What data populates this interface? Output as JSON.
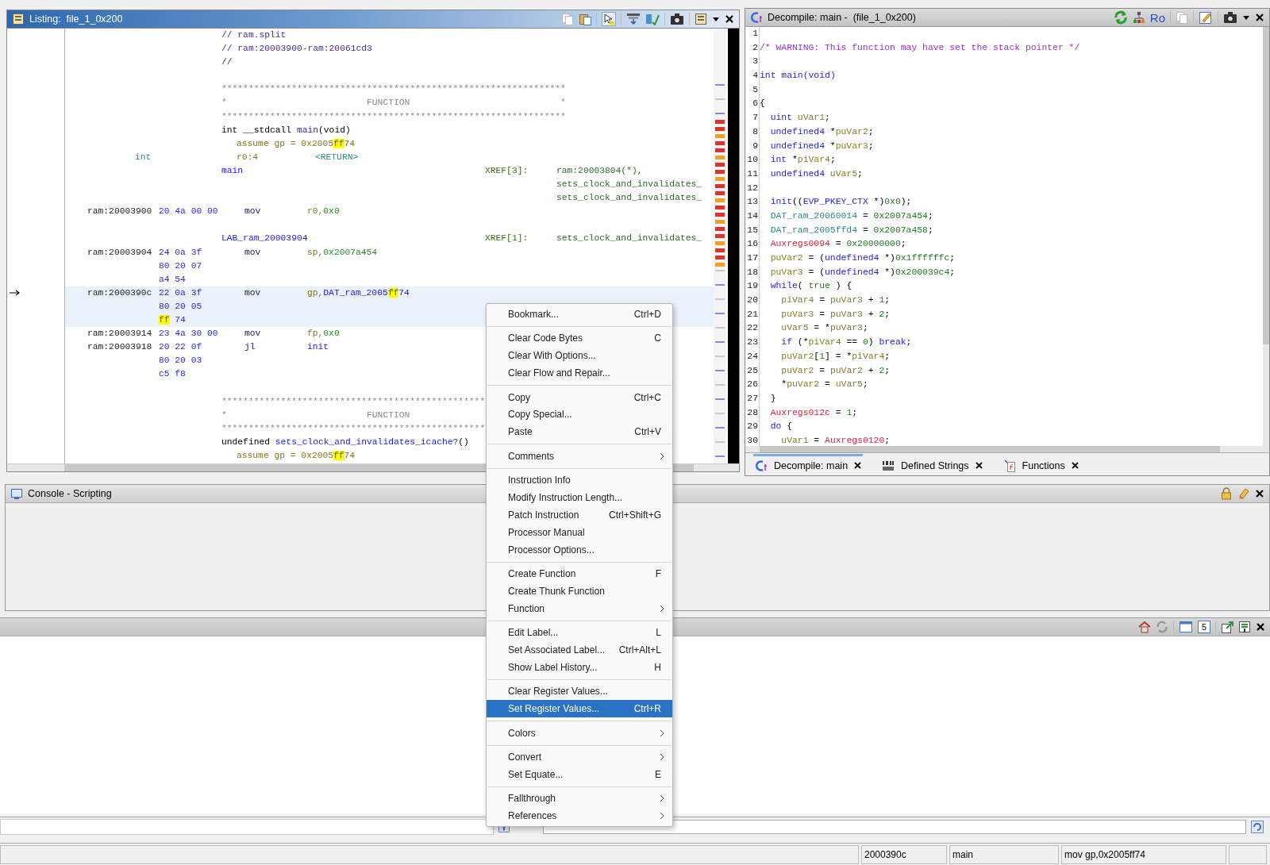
{
  "listing": {
    "title": "Listing:  file_1_0x200",
    "lines": [
      {
        "selected": false,
        "cells": [
          {
            "kind": "body",
            "parts": [
              {
                "text": "// ram.split",
                "kind": "comment"
              }
            ]
          }
        ]
      },
      {
        "selected": false,
        "cells": [
          {
            "kind": "body",
            "parts": [
              {
                "text": "// ram:20003900-ram:20061cd3",
                "kind": "comment"
              }
            ]
          }
        ]
      },
      {
        "selected": false,
        "cells": [
          {
            "kind": "body",
            "parts": [
              {
                "text": "//",
                "kind": "comment"
              }
            ]
          }
        ]
      },
      {
        "selected": false
      },
      {
        "selected": false,
        "cells": [
          {
            "kind": "body",
            "parts": [
              {
                "text": "****************************************************************",
                "kind": "stars"
              }
            ]
          }
        ]
      },
      {
        "selected": false,
        "cells": [
          {
            "kind": "body",
            "parts": [
              {
                "text": "*                          FUNCTION                            *",
                "kind": "stars"
              }
            ]
          }
        ]
      },
      {
        "selected": false,
        "cells": [
          {
            "kind": "body",
            "parts": [
              {
                "text": "****************************************************************",
                "kind": "stars"
              }
            ]
          }
        ]
      },
      {
        "selected": false,
        "cells": [
          {
            "kind": "body",
            "parts": [
              {
                "text": "int __stdcall",
                "kind": "plain"
              },
              {
                "text": " main",
                "kind": "label"
              },
              {
                "text": "(void)",
                "kind": "plain"
              }
            ]
          }
        ]
      },
      {
        "selected": false,
        "cells": [
          {
            "kind": "storage",
            "parts": [
              {
                "text": "assume gp = 0x2005",
                "kind": "olive"
              },
              {
                "text": "ff",
                "kind": "match"
              },
              {
                "text": "74",
                "kind": "olive"
              }
            ]
          }
        ]
      },
      {
        "selected": false,
        "cells": [
          {
            "kind": "type",
            "parts": [
              {
                "text": "int",
                "kind": "teal"
              }
            ]
          },
          {
            "kind": "storage",
            "parts": [
              {
                "text": "r0:4",
                "kind": "olive"
              }
            ]
          },
          {
            "kind": "return",
            "parts": [
              {
                "text": "<RETURN>",
                "kind": "teal"
              }
            ]
          }
        ]
      },
      {
        "selected": false,
        "cells": [
          {
            "kind": "body",
            "parts": [
              {
                "text": "main",
                "kind": "label"
              }
            ]
          },
          {
            "kind": "xref",
            "parts": [
              {
                "text": "XREF[3]:",
                "kind": "xref"
              }
            ]
          },
          {
            "kind": "target",
            "parts": [
              {
                "text": "ram:20003804(*),",
                "kind": "target"
              }
            ]
          }
        ]
      },
      {
        "selected": false,
        "cells": [
          {
            "kind": "target",
            "parts": [
              {
                "text": "sets_clock_and_invalidates_",
                "kind": "target"
              }
            ]
          }
        ]
      },
      {
        "selected": false,
        "cells": [
          {
            "kind": "target",
            "parts": [
              {
                "text": "sets_clock_and_invalidates_",
                "kind": "target"
              }
            ]
          }
        ]
      },
      {
        "selected": false,
        "cells": [
          {
            "kind": "address",
            "parts": [
              {
                "text": "ram:20003900",
                "kind": "address"
              }
            ]
          },
          {
            "kind": "bytes",
            "parts": [
              {
                "text": "20 4a 00 00",
                "kind": "bytes"
              }
            ]
          },
          {
            "kind": "mnemonic",
            "parts": [
              {
                "text": "mov",
                "kind": "mnemonic"
              }
            ]
          },
          {
            "kind": "operands",
            "parts": [
              {
                "text": "r0,",
                "kind": "olive"
              },
              {
                "text": "0x0",
                "kind": "scalar"
              }
            ]
          }
        ]
      },
      {
        "selected": false
      },
      {
        "selected": false,
        "cells": [
          {
            "kind": "body",
            "parts": [
              {
                "text": "LAB_ram_20003904",
                "kind": "label"
              }
            ]
          },
          {
            "kind": "xref",
            "parts": [
              {
                "text": "XREF[1]:",
                "kind": "xref"
              }
            ]
          },
          {
            "kind": "target",
            "parts": [
              {
                "text": "sets_clock_and_invalidates_",
                "kind": "target"
              }
            ]
          }
        ]
      },
      {
        "selected": false,
        "cells": [
          {
            "kind": "address",
            "parts": [
              {
                "text": "ram:20003904",
                "kind": "address"
              }
            ]
          },
          {
            "kind": "bytes",
            "parts": [
              {
                "text": "24 0a 3f",
                "kind": "bytes"
              }
            ]
          },
          {
            "kind": "mnemonic",
            "parts": [
              {
                "text": "mov",
                "kind": "mnemonic"
              }
            ]
          },
          {
            "kind": "operands",
            "parts": [
              {
                "text": "sp,",
                "kind": "olive"
              },
              {
                "text": "0x2007a454",
                "kind": "scalar"
              }
            ]
          }
        ]
      },
      {
        "selected": false,
        "cells": [
          {
            "kind": "bytes",
            "parts": [
              {
                "text": "80 20 07",
                "kind": "bytes"
              }
            ]
          }
        ]
      },
      {
        "selected": false,
        "cells": [
          {
            "kind": "bytes",
            "parts": [
              {
                "text": "a4 54",
                "kind": "bytes"
              }
            ]
          }
        ]
      },
      {
        "selected": true,
        "cells": [
          {
            "kind": "address",
            "parts": [
              {
                "text": "ram:2000390c",
                "kind": "address"
              }
            ]
          },
          {
            "kind": "bytes",
            "parts": [
              {
                "text": "22 0a 3f",
                "kind": "bytes"
              }
            ]
          },
          {
            "kind": "mnemonic",
            "parts": [
              {
                "text": "mov",
                "kind": "mnemonic"
              }
            ]
          },
          {
            "kind": "operands",
            "parts": [
              {
                "text": "gp,",
                "kind": "olive"
              },
              {
                "text": "DAT_ram_2005",
                "kind": "label"
              },
              {
                "text": "ff",
                "kind": "match"
              },
              {
                "text": "74",
                "kind": "label"
              }
            ]
          }
        ]
      },
      {
        "selected": true,
        "cells": [
          {
            "kind": "bytes",
            "parts": [
              {
                "text": "80 20 05",
                "kind": "bytes"
              }
            ]
          }
        ]
      },
      {
        "selected": true,
        "cells": [
          {
            "kind": "bytes",
            "parts": [
              {
                "text": "ff",
                "kind": "match"
              },
              {
                "text": " 74",
                "kind": "bytes"
              }
            ]
          }
        ]
      },
      {
        "selected": false,
        "cells": [
          {
            "kind": "address",
            "parts": [
              {
                "text": "ram:20003914",
                "kind": "address"
              }
            ]
          },
          {
            "kind": "bytes",
            "parts": [
              {
                "text": "23 4a 30 00",
                "kind": "bytes"
              }
            ]
          },
          {
            "kind": "mnemonic",
            "parts": [
              {
                "text": "mov",
                "kind": "mnemonic"
              }
            ]
          },
          {
            "kind": "operands",
            "parts": [
              {
                "text": "fp,",
                "kind": "olive"
              },
              {
                "text": "0x0",
                "kind": "scalar"
              }
            ]
          }
        ]
      },
      {
        "selected": false,
        "cells": [
          {
            "kind": "address",
            "parts": [
              {
                "text": "ram:20003918",
                "kind": "address"
              }
            ]
          },
          {
            "kind": "bytes",
            "parts": [
              {
                "text": "20 22 0f",
                "kind": "bytes"
              }
            ]
          },
          {
            "kind": "mnemonic",
            "parts": [
              {
                "text": "jl",
                "kind": "mnemonic"
              }
            ]
          },
          {
            "kind": "operands",
            "parts": [
              {
                "text": "init",
                "kind": "label"
              }
            ]
          }
        ]
      },
      {
        "selected": false,
        "cells": [
          {
            "kind": "bytes",
            "parts": [
              {
                "text": "80 20 03",
                "kind": "bytes"
              }
            ]
          }
        ]
      },
      {
        "selected": false,
        "cells": [
          {
            "kind": "bytes",
            "parts": [
              {
                "text": "c5 f8",
                "kind": "bytes"
              }
            ]
          }
        ]
      },
      {
        "selected": false
      },
      {
        "selected": false,
        "cells": [
          {
            "kind": "body",
            "parts": [
              {
                "text": "*************************************************",
                "kind": "stars"
              }
            ]
          }
        ]
      },
      {
        "selected": false,
        "cells": [
          {
            "kind": "body",
            "parts": [
              {
                "text": "*                          FUNCTION",
                "kind": "stars"
              }
            ]
          }
        ]
      },
      {
        "selected": false,
        "cells": [
          {
            "kind": "body",
            "parts": [
              {
                "text": "*************************************************",
                "kind": "stars"
              }
            ]
          }
        ]
      },
      {
        "selected": false,
        "cells": [
          {
            "kind": "body",
            "parts": [
              {
                "text": "undefined",
                "kind": "plain"
              },
              {
                "text": " sets_clock_and_invalidates_icache?",
                "kind": "label"
              },
              {
                "text": "()",
                "kind": "plain"
              }
            ]
          }
        ]
      },
      {
        "selected": false,
        "cells": [
          {
            "kind": "storage",
            "parts": [
              {
                "text": "assume gp = 0x2005",
                "kind": "olive"
              },
              {
                "text": "ff",
                "kind": "match"
              },
              {
                "text": "74",
                "kind": "olive"
              }
            ]
          }
        ]
      }
    ]
  },
  "decompile": {
    "title": "Decompile: main -  (file_1_0x200)",
    "toolbar_text": "Ro",
    "lines": [
      {
        "number": "1"
      },
      {
        "number": "2",
        "parts": [
          {
            "text": "/* WARNING: This function may have set the stack pointer */",
            "kind": "comment"
          }
        ]
      },
      {
        "number": "3"
      },
      {
        "number": "4",
        "parts": [
          {
            "text": "int",
            "kind": "type"
          },
          {
            "text": " main",
            "kind": "func"
          },
          {
            "text": "(void)",
            "kind": "type"
          }
        ]
      },
      {
        "number": "5"
      },
      {
        "number": "6",
        "parts": [
          {
            "text": "{"
          }
        ]
      },
      {
        "number": "7",
        "parts": [
          {
            "text": "  uint",
            "kind": "type"
          },
          {
            "text": " uVar1",
            "kind": "var"
          },
          {
            "text": ";"
          }
        ]
      },
      {
        "number": "8",
        "parts": [
          {
            "text": "  undefined4",
            "kind": "type"
          },
          {
            "text": " *"
          },
          {
            "text": "puVar2",
            "kind": "var"
          },
          {
            "text": ";"
          }
        ]
      },
      {
        "number": "9",
        "parts": [
          {
            "text": "  undefined4",
            "kind": "type"
          },
          {
            "text": " *"
          },
          {
            "text": "puVar3",
            "kind": "var"
          },
          {
            "text": ";"
          }
        ]
      },
      {
        "number": "10",
        "parts": [
          {
            "text": "  int",
            "kind": "type"
          },
          {
            "text": " *"
          },
          {
            "text": "piVar4",
            "kind": "var"
          },
          {
            "text": ";"
          }
        ]
      },
      {
        "number": "11",
        "parts": [
          {
            "text": "  undefined4",
            "kind": "type"
          },
          {
            "text": " uVar5",
            "kind": "var"
          },
          {
            "text": ";"
          }
        ]
      },
      {
        "number": "12"
      },
      {
        "number": "13",
        "parts": [
          {
            "text": "  init",
            "kind": "func"
          },
          {
            "text": "(("
          },
          {
            "text": "EVP_PKEY_CTX",
            "kind": "type"
          },
          {
            "text": " *)"
          },
          {
            "text": "0x0",
            "kind": "const"
          },
          {
            "text": ");"
          }
        ]
      },
      {
        "number": "14",
        "parts": [
          {
            "text": "  DAT_ram_20060014",
            "kind": "global"
          },
          {
            "text": " = "
          },
          {
            "text": "0x2007a454",
            "kind": "const"
          },
          {
            "text": ";"
          }
        ]
      },
      {
        "number": "15",
        "parts": [
          {
            "text": "  DAT_ram_2005ffd4",
            "kind": "global"
          },
          {
            "text": " = "
          },
          {
            "text": "0x2007a458",
            "kind": "const"
          },
          {
            "text": ";"
          }
        ]
      },
      {
        "number": "16",
        "parts": [
          {
            "text": "  Auxregs0094",
            "kind": "reg"
          },
          {
            "text": " = "
          },
          {
            "text": "0x20000000",
            "kind": "const"
          },
          {
            "text": ";"
          }
        ]
      },
      {
        "number": "17",
        "parts": [
          {
            "text": "  puVar2",
            "kind": "var"
          },
          {
            "text": " = ("
          },
          {
            "text": "undefined4",
            "kind": "type"
          },
          {
            "text": " *)"
          },
          {
            "text": "0x1ffffffc",
            "kind": "const"
          },
          {
            "text": ";"
          }
        ]
      },
      {
        "number": "18",
        "parts": [
          {
            "text": "  puVar3",
            "kind": "var"
          },
          {
            "text": " = ("
          },
          {
            "text": "undefined4",
            "kind": "type"
          },
          {
            "text": " *)"
          },
          {
            "text": "0x200039c4",
            "kind": "const"
          },
          {
            "text": ";"
          }
        ]
      },
      {
        "number": "19",
        "parts": [
          {
            "text": "  while",
            "kind": "type"
          },
          {
            "text": "( "
          },
          {
            "text": "true",
            "kind": "const"
          },
          {
            "text": " ) {"
          }
        ]
      },
      {
        "number": "20",
        "parts": [
          {
            "text": "    piVar4",
            "kind": "var"
          },
          {
            "text": " = "
          },
          {
            "text": "puVar3",
            "kind": "var"
          },
          {
            "text": " + "
          },
          {
            "text": "1",
            "kind": "const"
          },
          {
            "text": ";"
          }
        ]
      },
      {
        "number": "21",
        "parts": [
          {
            "text": "    puVar3",
            "kind": "var"
          },
          {
            "text": " = "
          },
          {
            "text": "puVar3",
            "kind": "var"
          },
          {
            "text": " + "
          },
          {
            "text": "2",
            "kind": "const"
          },
          {
            "text": ";"
          }
        ]
      },
      {
        "number": "22",
        "parts": [
          {
            "text": "    uVar5",
            "kind": "var"
          },
          {
            "text": " = *"
          },
          {
            "text": "puVar3",
            "kind": "var"
          },
          {
            "text": ";"
          }
        ]
      },
      {
        "number": "23",
        "parts": [
          {
            "text": "    if",
            "kind": "type"
          },
          {
            "text": " (*"
          },
          {
            "text": "piVar4",
            "kind": "var"
          },
          {
            "text": " == "
          },
          {
            "text": "0",
            "kind": "const"
          },
          {
            "text": ") "
          },
          {
            "text": "break",
            "kind": "type"
          },
          {
            "text": ";"
          }
        ]
      },
      {
        "number": "24",
        "parts": [
          {
            "text": "    puVar2",
            "kind": "var"
          },
          {
            "text": "["
          },
          {
            "text": "1",
            "kind": "const"
          },
          {
            "text": "] = *"
          },
          {
            "text": "piVar4",
            "kind": "var"
          },
          {
            "text": ";"
          }
        ]
      },
      {
        "number": "25",
        "parts": [
          {
            "text": "    puVar2",
            "kind": "var"
          },
          {
            "text": " = "
          },
          {
            "text": "puVar2",
            "kind": "var"
          },
          {
            "text": " + "
          },
          {
            "text": "2",
            "kind": "const"
          },
          {
            "text": ";"
          }
        ]
      },
      {
        "number": "26",
        "parts": [
          {
            "text": "    *"
          },
          {
            "text": "puVar2",
            "kind": "var"
          },
          {
            "text": " = "
          },
          {
            "text": "uVar5",
            "kind": "var"
          },
          {
            "text": ";"
          }
        ]
      },
      {
        "number": "27",
        "parts": [
          {
            "text": "  }"
          }
        ]
      },
      {
        "number": "28",
        "parts": [
          {
            "text": "  Auxregs012c",
            "kind": "reg"
          },
          {
            "text": " = "
          },
          {
            "text": "1",
            "kind": "const"
          },
          {
            "text": ";"
          }
        ]
      },
      {
        "number": "29",
        "parts": [
          {
            "text": "  do",
            "kind": "type"
          },
          {
            "text": " {"
          }
        ]
      },
      {
        "number": "30",
        "parts": [
          {
            "text": "    uVar1",
            "kind": "var"
          },
          {
            "text": " = "
          },
          {
            "text": "Auxregs0120",
            "kind": "reg"
          },
          {
            "text": ";"
          }
        ]
      }
    ],
    "tabs": [
      {
        "label": "Decompile: main",
        "selected": true
      },
      {
        "label": "Defined Strings",
        "selected": false
      },
      {
        "label": "Functions",
        "selected": false
      }
    ]
  },
  "console": {
    "title": "Console - Scripting"
  },
  "bottom_panel": {
    "badge": "5"
  },
  "status_bar": [
    "2000390c",
    "main",
    "mov gp,0x2005ff74"
  ],
  "context_menu": {
    "groups": [
      [
        {
          "label": "Bookmark...",
          "shortcut": "Ctrl+D",
          "submenu": false,
          "selected": false
        }
      ],
      [
        {
          "label": "Clear Code Bytes",
          "shortcut": "C",
          "submenu": false,
          "selected": false
        },
        {
          "label": "Clear With Options...",
          "submenu": false,
          "selected": false
        },
        {
          "label": "Clear Flow and Repair...",
          "submenu": false,
          "selected": false
        }
      ],
      [
        {
          "label": "Copy",
          "shortcut": "Ctrl+C",
          "submenu": false,
          "selected": false
        },
        {
          "label": "Copy Special...",
          "submenu": false,
          "selected": false
        },
        {
          "label": "Paste",
          "shortcut": "Ctrl+V",
          "submenu": false,
          "selected": false
        }
      ],
      [
        {
          "label": "Comments",
          "submenu": true,
          "selected": false
        }
      ],
      [
        {
          "label": "Instruction Info",
          "submenu": false,
          "selected": false
        },
        {
          "label": "Modify Instruction Length...",
          "submenu": false,
          "selected": false
        },
        {
          "label": "Patch Instruction",
          "shortcut": "Ctrl+Shift+G",
          "submenu": false,
          "selected": false
        },
        {
          "label": "Processor Manual",
          "submenu": false,
          "selected": false
        },
        {
          "label": "Processor Options...",
          "submenu": false,
          "selected": false
        }
      ],
      [
        {
          "label": "Create Function",
          "shortcut": "F",
          "submenu": false,
          "selected": false
        },
        {
          "label": "Create Thunk Function",
          "submenu": false,
          "selected": false
        },
        {
          "label": "Function",
          "submenu": true,
          "selected": false
        }
      ],
      [
        {
          "label": "Edit Label...",
          "shortcut": "L",
          "submenu": false,
          "selected": false
        },
        {
          "label": "Set Associated Label...",
          "shortcut": "Ctrl+Alt+L",
          "submenu": false,
          "selected": false
        },
        {
          "label": "Show Label History...",
          "shortcut": "H",
          "submenu": false,
          "selected": false
        }
      ],
      [
        {
          "label": "Clear Register Values...",
          "submenu": false,
          "selected": false
        },
        {
          "label": "Set Register Values...",
          "shortcut": "Ctrl+R",
          "submenu": false,
          "selected": true
        }
      ],
      [
        {
          "label": "Colors",
          "submenu": true,
          "selected": false
        }
      ],
      [
        {
          "label": "Convert",
          "submenu": true,
          "selected": false
        },
        {
          "label": "Set Equate...",
          "shortcut": "E",
          "submenu": false,
          "selected": false
        }
      ],
      [
        {
          "label": "Fallthrough",
          "submenu": true,
          "selected": false
        },
        {
          "label": "References",
          "submenu": true,
          "selected": false
        }
      ]
    ]
  }
}
